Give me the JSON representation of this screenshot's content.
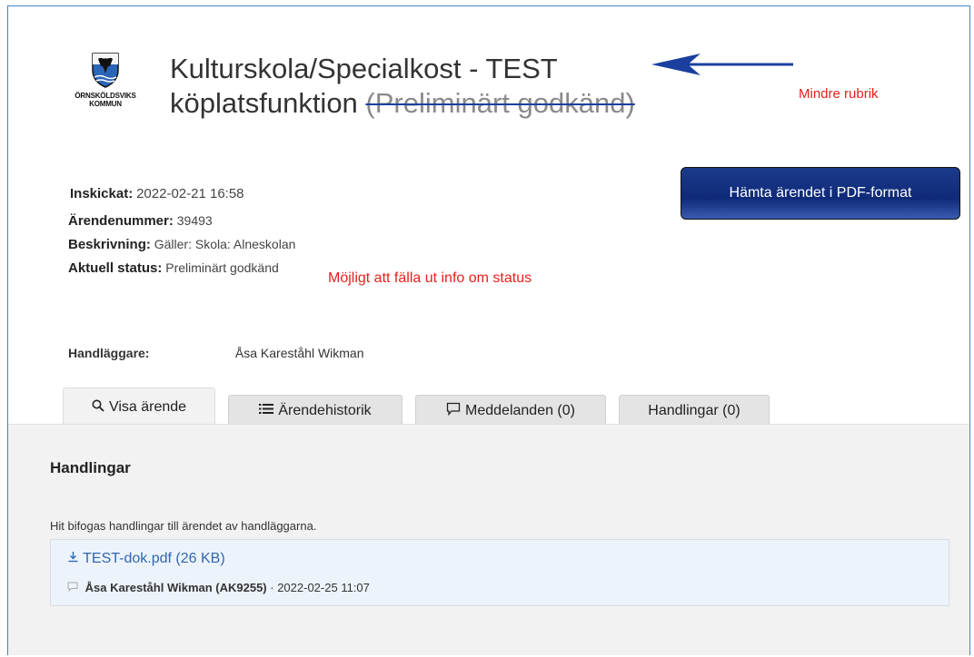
{
  "logo": {
    "line1": "ÖRNSKÖLDSVIKS",
    "line2": "KOMMUN"
  },
  "title": {
    "line1": "Kulturskola/Specialkost - TEST",
    "line2_main": "köplatsfunktion ",
    "line2_struck": "(Preliminärt godkänd)"
  },
  "annotations": {
    "heading_note": "Mindre rubrik",
    "status_note": "Möjligt att fälla ut info om status",
    "arrow_color": "#1a3f9e",
    "note_color": "#e8201c"
  },
  "actions": {
    "pdf_button": "Hämta ärendet i PDF-format"
  },
  "case": {
    "submitted_label": "Inskickat:",
    "submitted_value": "2022-02-21 16:58",
    "number_label": "Ärendenummer:",
    "number_value": "39493",
    "description_label": "Beskrivning:",
    "description_value": "Gäller: Skola: Alneskolan",
    "status_label": "Aktuell status:",
    "status_value": "Preliminärt godkänd",
    "handler_label": "Handläggare:",
    "handler_value": "Åsa Kareståhl Wikman"
  },
  "tabs": [
    {
      "label": "Visa ärende",
      "icon": "search-icon",
      "active": true
    },
    {
      "label": "Ärendehistorik",
      "icon": "list-icon",
      "active": false
    },
    {
      "label": "Meddelanden (0)",
      "icon": "comment-icon",
      "active": false
    },
    {
      "label": "Handlingar (0)",
      "icon": "",
      "active": false
    }
  ],
  "panel": {
    "heading": "Handlingar",
    "intro": "Hit bifogas handlingar till ärendet av handläggarna.",
    "document": {
      "name": "TEST-dok.pdf (26 KB)",
      "icon": "download-icon",
      "uploader": "Åsa Kareståhl Wikman (AK9255)",
      "separator": " · ",
      "timestamp": "2022-02-25 11:07"
    }
  }
}
